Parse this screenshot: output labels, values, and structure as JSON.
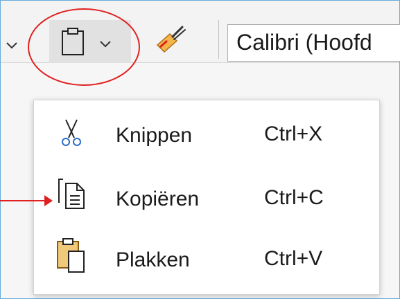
{
  "toolbar": {
    "font_name": "Calibri (Hoofd",
    "icons": [
      "chevron-down-icon",
      "clipboard-icon",
      "chevron-down-icon",
      "format-painter-icon"
    ]
  },
  "menu": {
    "items": [
      {
        "label": "Knippen",
        "shortcut": "Ctrl+X",
        "icon": "scissors-icon"
      },
      {
        "label": "Kopiëren",
        "shortcut": "Ctrl+C",
        "icon": "copy-icon"
      },
      {
        "label": "Plakken",
        "shortcut": "Ctrl+V",
        "icon": "paste-icon"
      }
    ]
  },
  "annotation": {
    "highlight_color": "#e0201f"
  },
  "colors": {
    "window_border": "#6aa9d8",
    "toolbar_bg": "#f3f3f3",
    "button_hover_bg": "#e1e1e1",
    "menu_bg": "#ffffff"
  }
}
